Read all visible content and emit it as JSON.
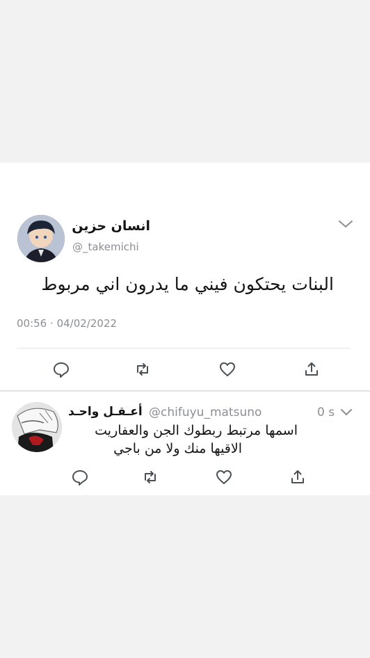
{
  "tweet": {
    "display_name": "انسان حزين",
    "handle": "@_takemichi",
    "text": "البنات يحتكون فيني ما يدرون اني مربوط",
    "time": "00:56",
    "separator": "·",
    "date": "04/02/2022",
    "actions": [
      "reply-icon",
      "retweet-icon",
      "like-icon",
      "share-icon"
    ]
  },
  "reply": {
    "display_name": "أعـقـل واحـد",
    "handle": "@chifuyu_matsuno",
    "time": "0 s",
    "text_line1": "اسمها مرتبط ربطوك الجن والعفاريت",
    "text_line2": "الاقيها منك ولا من باجي",
    "actions": [
      "reply-icon",
      "retweet-icon",
      "like-icon",
      "share-icon"
    ]
  },
  "colors": {
    "page_bg": "#f2f2f2",
    "card_bg": "#ffffff",
    "secondary_text": "#8a8f94",
    "icon": "#4a4f55"
  }
}
